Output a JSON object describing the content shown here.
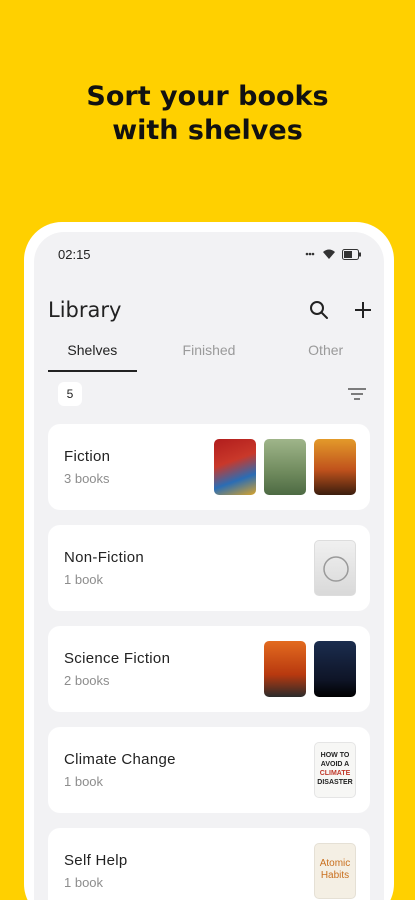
{
  "promo": {
    "line1": "Sort your books",
    "line2": "with shelves"
  },
  "status": {
    "time": "02:15",
    "icons": [
      "silent-icon",
      "wifi-icon",
      "battery-icon"
    ]
  },
  "header": {
    "title": "Library",
    "search_icon": "search-icon",
    "add_icon": "plus-icon"
  },
  "tabs": [
    {
      "label": "Shelves",
      "active": true
    },
    {
      "label": "Finished",
      "active": false
    },
    {
      "label": "Other",
      "active": false
    }
  ],
  "filter": {
    "count": "5",
    "sort_icon": "sort-icon"
  },
  "shelves": [
    {
      "name": "Fiction",
      "count": "3 books"
    },
    {
      "name": "Non-Fiction",
      "count": "1 book"
    },
    {
      "name": "Science Fiction",
      "count": "2 books"
    },
    {
      "name": "Climate Change",
      "count": "1 book"
    },
    {
      "name": "Self Help",
      "count": "1 book"
    }
  ],
  "covers": {
    "atomic_habits": {
      "line1": "Atomic",
      "line2": "Habits"
    },
    "climate": {
      "line1": "HOW TO",
      "line2": "AVOID A",
      "line3": "CLIMATE",
      "line4": "DISASTER"
    }
  },
  "colors": {
    "accent": "#FFD000",
    "screen_bg": "#F2F2F4",
    "card_bg": "#FFFFFF"
  }
}
